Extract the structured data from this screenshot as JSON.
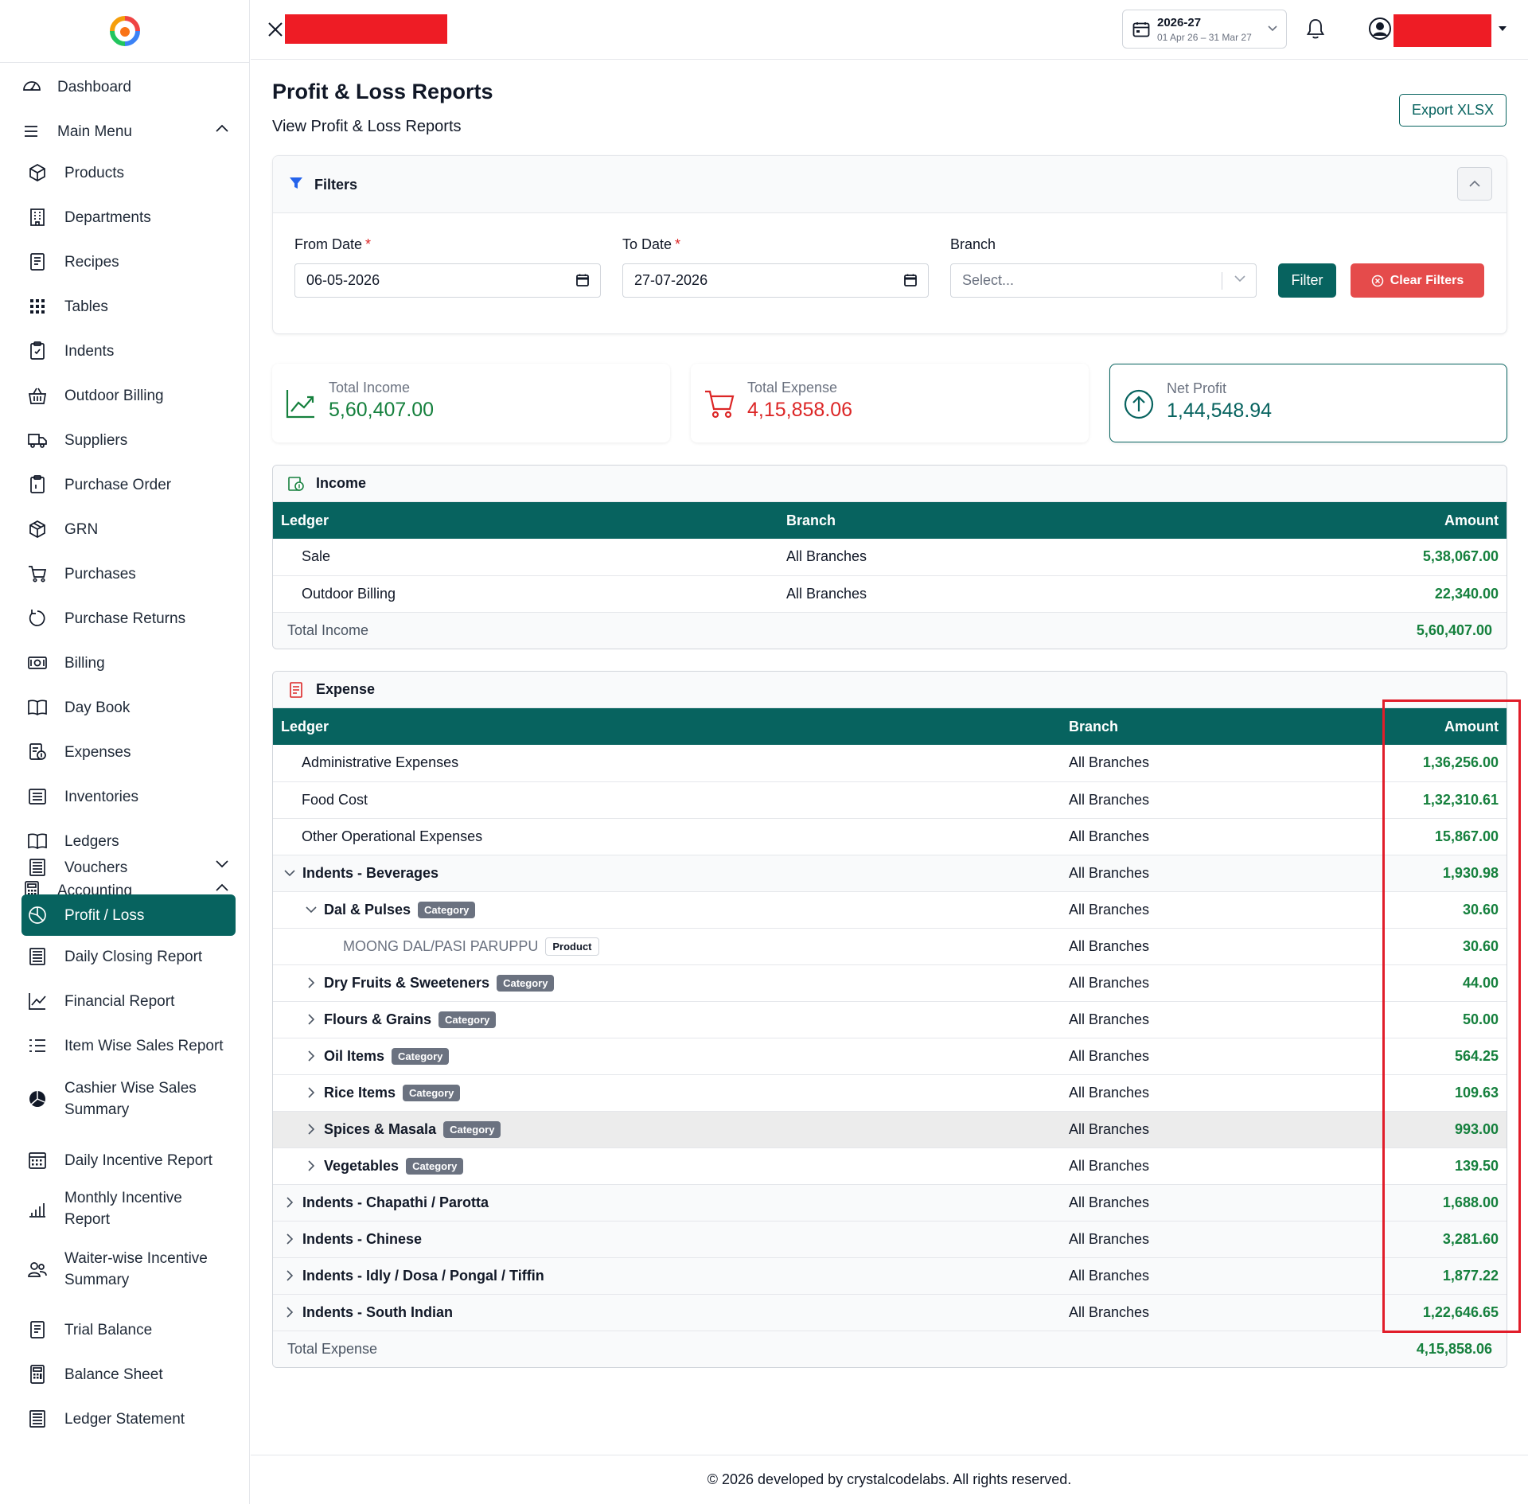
{
  "topbar": {
    "fy_year": "2026-27",
    "fy_range": "01 Apr 26 – 31 Mar 27"
  },
  "sidebar": {
    "top_items": [
      {
        "label": "Dashboard",
        "icon": "dashboard-gauge-icon"
      },
      {
        "label": "Main Menu",
        "icon": "menu-lines-icon"
      }
    ],
    "main_items": [
      {
        "label": "Products",
        "icon": "box-icon"
      },
      {
        "label": "Departments",
        "icon": "building-icon"
      },
      {
        "label": "Recipes",
        "icon": "recipe-doc-icon"
      },
      {
        "label": "Tables",
        "icon": "grid-dots-icon"
      },
      {
        "label": "Indents",
        "icon": "clipboard-icon"
      },
      {
        "label": "Outdoor Billing",
        "icon": "basket-icon"
      },
      {
        "label": "Suppliers",
        "icon": "truck-icon"
      },
      {
        "label": "Purchase Order",
        "icon": "clipboard-check-icon"
      },
      {
        "label": "GRN",
        "icon": "package-icon"
      },
      {
        "label": "Purchases",
        "icon": "cart-icon"
      },
      {
        "label": "Purchase Returns",
        "icon": "return-circle-icon"
      },
      {
        "label": "Billing",
        "icon": "cash-icon"
      },
      {
        "label": "Day Book",
        "icon": "book-open-icon"
      },
      {
        "label": "Expenses",
        "icon": "expense-doc-icon"
      },
      {
        "label": "Inventories",
        "icon": "list-box-icon"
      },
      {
        "label": "Ledgers",
        "icon": "ledger-book-icon"
      }
    ],
    "accounting": {
      "label": "Accounting",
      "icon": "calculator-icon"
    },
    "accounting_items": [
      {
        "label": "Vouchers",
        "icon": "voucher-icon"
      },
      {
        "label": "Profit / Loss",
        "icon": "pie-chart-icon"
      },
      {
        "label": "Daily Closing Report",
        "icon": "report-doc-icon"
      },
      {
        "label": "Financial Report",
        "icon": "trend-chart-icon"
      },
      {
        "label": "Item Wise Sales Report",
        "icon": "list-numbered-icon"
      },
      {
        "label": "Cashier Wise Sales Summary",
        "icon": "pie-solid-icon"
      },
      {
        "label": "Daily Incentive Report",
        "icon": "calendar-grid-icon"
      },
      {
        "label": "Monthly Incentive Report",
        "icon": "bar-signal-icon"
      },
      {
        "label": "Waiter-wise Incentive Summary",
        "icon": "users-icon"
      },
      {
        "label": "Trial Balance",
        "icon": "trial-doc-icon"
      },
      {
        "label": "Balance Sheet",
        "icon": "balance-calc-icon"
      },
      {
        "label": "Ledger Statement",
        "icon": "statement-doc-icon"
      }
    ]
  },
  "page": {
    "title": "Profit & Loss Reports",
    "subtitle": "View Profit & Loss Reports",
    "export_label": "Export XLSX"
  },
  "filters": {
    "title": "Filters",
    "from_label": "From Date",
    "from_value": "06-05-2026",
    "to_label": "To Date",
    "to_value": "27-07-2026",
    "branch_label": "Branch",
    "branch_placeholder": "Select...",
    "filter_button": "Filter",
    "clear_button": "Clear Filters",
    "required_mark": "*"
  },
  "summary": {
    "income_label": "Total Income",
    "income_value": "5,60,407.00",
    "expense_label": "Total Expense",
    "expense_value": "4,15,858.06",
    "net_label": "Net Profit",
    "net_value": "1,44,548.94"
  },
  "colors": {
    "primary": "#07635f",
    "income_green": "#15803d",
    "expense_red": "#dc2626",
    "clear_btn": "#e54b4b"
  },
  "income": {
    "title": "Income",
    "headers": {
      "ledger": "Ledger",
      "branch": "Branch",
      "amount": "Amount"
    },
    "rows": [
      {
        "ledger": "Sale",
        "branch": "All Branches",
        "amount": "5,38,067.00"
      },
      {
        "ledger": "Outdoor Billing",
        "branch": "All Branches",
        "amount": "22,340.00"
      }
    ],
    "total_label": "Total Income",
    "total_value": "5,60,407.00"
  },
  "expense": {
    "title": "Expense",
    "headers": {
      "ledger": "Ledger",
      "branch": "Branch",
      "amount": "Amount"
    },
    "rows": [
      {
        "ledger": "Administrative Expenses",
        "branch": "All Branches",
        "amount": "1,36,256.00",
        "level": 0,
        "toggle": "none",
        "badge": ""
      },
      {
        "ledger": "Food Cost",
        "branch": "All Branches",
        "amount": "1,32,310.61",
        "level": 0,
        "toggle": "none",
        "badge": ""
      },
      {
        "ledger": "Other Operational Expenses",
        "branch": "All Branches",
        "amount": "15,867.00",
        "level": 0,
        "toggle": "none",
        "badge": ""
      },
      {
        "ledger": "Indents - Beverages",
        "branch": "All Branches",
        "amount": "1,930.98",
        "level": 0,
        "toggle": "open",
        "badge": ""
      },
      {
        "ledger": "Dal & Pulses",
        "branch": "All Branches",
        "amount": "30.60",
        "level": 1,
        "toggle": "open",
        "badge": "Category"
      },
      {
        "ledger": "MOONG DAL/PASI PARUPPU",
        "branch": "All Branches",
        "amount": "30.60",
        "level": 2,
        "toggle": "none",
        "badge": "Product"
      },
      {
        "ledger": "Dry Fruits & Sweeteners",
        "branch": "All Branches",
        "amount": "44.00",
        "level": 1,
        "toggle": "closed",
        "badge": "Category"
      },
      {
        "ledger": "Flours & Grains",
        "branch": "All Branches",
        "amount": "50.00",
        "level": 1,
        "toggle": "closed",
        "badge": "Category"
      },
      {
        "ledger": "Oil Items",
        "branch": "All Branches",
        "amount": "564.25",
        "level": 1,
        "toggle": "closed",
        "badge": "Category"
      },
      {
        "ledger": "Rice Items",
        "branch": "All Branches",
        "amount": "109.63",
        "level": 1,
        "toggle": "closed",
        "badge": "Category"
      },
      {
        "ledger": "Spices & Masala",
        "branch": "All Branches",
        "amount": "993.00",
        "level": 1,
        "toggle": "closed",
        "badge": "Category"
      },
      {
        "ledger": "Vegetables",
        "branch": "All Branches",
        "amount": "139.50",
        "level": 1,
        "toggle": "closed",
        "badge": "Category"
      },
      {
        "ledger": "Indents - Chapathi / Parotta",
        "branch": "All Branches",
        "amount": "1,688.00",
        "level": 0,
        "toggle": "closed",
        "badge": ""
      },
      {
        "ledger": "Indents - Chinese",
        "branch": "All Branches",
        "amount": "3,281.60",
        "level": 0,
        "toggle": "closed",
        "badge": ""
      },
      {
        "ledger": "Indents - Idly / Dosa / Pongal / Tiffin",
        "branch": "All Branches",
        "amount": "1,877.22",
        "level": 0,
        "toggle": "closed",
        "badge": ""
      },
      {
        "ledger": "Indents - South Indian",
        "branch": "All Branches",
        "amount": "1,22,646.65",
        "level": 0,
        "toggle": "closed",
        "badge": ""
      }
    ],
    "total_label": "Total Expense",
    "total_value": "4,15,858.06"
  },
  "footer": {
    "text": "© 2026 developed by crystalcodelabs. All rights reserved."
  }
}
